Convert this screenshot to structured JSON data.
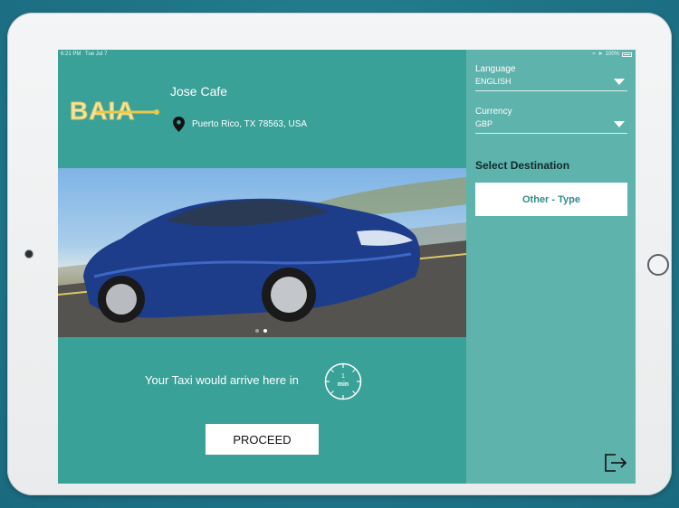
{
  "status_bar": {
    "time": "6:21 PM",
    "date": "Tue Jul 7",
    "battery": "100%"
  },
  "venue": {
    "name": "Jose Cafe",
    "address": "Puerto Rico, TX 78563, USA",
    "logo_text": "BAIA"
  },
  "eta": {
    "text": "Your Taxi would arrive here in",
    "value": "1",
    "unit": "min"
  },
  "proceed_label": "PROCEED",
  "language": {
    "label": "Language",
    "value": "ENGLISH"
  },
  "currency": {
    "label": "Currency",
    "value": "GBP"
  },
  "destination": {
    "title": "Select Destination",
    "option": "Other - Type"
  },
  "carousel": {
    "count": 2,
    "active_index": 1
  },
  "colors": {
    "teal": "#3aa199",
    "panel": "#5fb3ad",
    "logo_yellow": "#e8c84a"
  }
}
